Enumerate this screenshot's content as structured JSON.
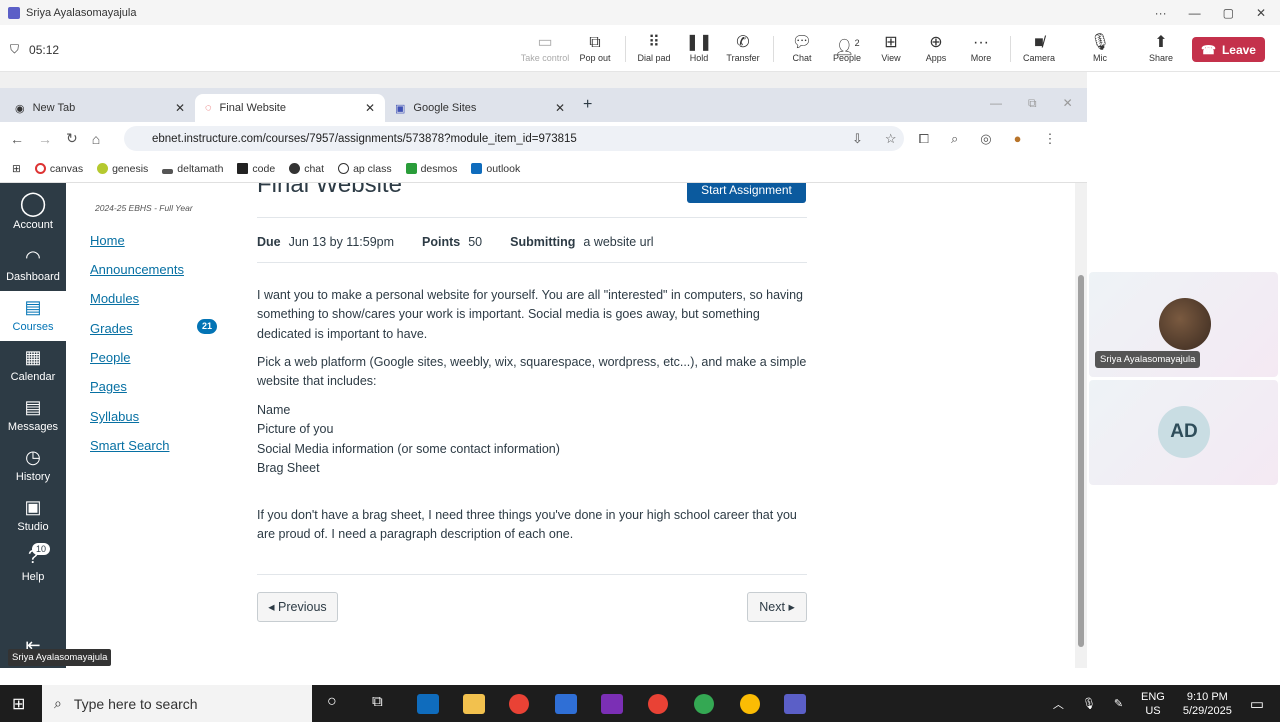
{
  "teams": {
    "window_title": "Sriya Ayalasomayajula",
    "timer": "05:12",
    "toolbar": [
      {
        "label": "Take control",
        "icon": "monitor-icon",
        "disabled": true
      },
      {
        "label": "Pop out",
        "icon": "popout-icon"
      },
      {
        "label": "Dial pad",
        "icon": "dialpad-icon"
      },
      {
        "label": "Hold",
        "icon": "pause-icon"
      },
      {
        "label": "Transfer",
        "icon": "transfer-icon"
      },
      {
        "label": "Chat",
        "icon": "chat-icon"
      },
      {
        "label": "People",
        "icon": "people-icon",
        "count": "2"
      },
      {
        "label": "View",
        "icon": "grid-icon"
      },
      {
        "label": "Apps",
        "icon": "plus-icon"
      },
      {
        "label": "More",
        "icon": "more-icon"
      },
      {
        "label": "Camera",
        "icon": "camera-off-icon"
      },
      {
        "label": "Mic",
        "icon": "mic-icon"
      },
      {
        "label": "Share",
        "icon": "share-icon"
      }
    ],
    "leave": "Leave",
    "participants": [
      {
        "name": "Sriya Ayalasomayajula"
      },
      {
        "initials": "AD"
      }
    ],
    "self_label": "Sriya Ayalasomayajula"
  },
  "browser": {
    "tabs": [
      {
        "label": "New Tab"
      },
      {
        "label": "Final Website"
      },
      {
        "label": "Google Sites"
      }
    ],
    "url": "ebnet.instructure.com/courses/7957/assignments/573878?module_item_id=973815",
    "bookmarks": [
      "canvas",
      "genesis",
      "deltamath",
      "code",
      "chat",
      "ap class",
      "desmos",
      "outlook"
    ]
  },
  "canvas": {
    "global_nav": [
      {
        "label": "Account"
      },
      {
        "label": "Dashboard"
      },
      {
        "label": "Courses"
      },
      {
        "label": "Calendar"
      },
      {
        "label": "Messages"
      },
      {
        "label": "History"
      },
      {
        "label": "Studio"
      },
      {
        "label": "Help",
        "badge": "10"
      }
    ],
    "term": "2024-25 EBHS - Full Year",
    "course_nav": [
      "Home",
      "Announcements",
      "Modules",
      "Grades",
      "People",
      "Pages",
      "Syllabus",
      "Smart Search"
    ],
    "grades_badge": "21",
    "assignment": {
      "title": "Final Website",
      "start_button": "Start Assignment",
      "due_label": "Due",
      "due": "Jun 13 by 11:59pm",
      "points_label": "Points",
      "points": "50",
      "submitting_label": "Submitting",
      "submitting": "a website url",
      "p1": "I want you to make a personal website for yourself. You are all \"interested\" in computers, so having something to show/cares your work is important. Social media is goes away, but something dedicated is important to have.",
      "p2": "Pick a web platform (Google sites, weebly, wix, squarespace, wordpress, etc...), and make a simple website that includes:",
      "list": [
        "Name",
        "Picture of you",
        "Social Media information (or some contact information)",
        "Brag Sheet"
      ],
      "p3": "If you don't have a brag sheet, I need three things you've done in your high school career that you are proud of. I need a paragraph description of each one.",
      "prev": "◂ Previous",
      "next": "Next ▸"
    }
  },
  "taskbar": {
    "search_placeholder": "Type here to search",
    "lang1": "ENG",
    "lang2": "US",
    "time": "9:10 PM",
    "date": "5/29/2025"
  }
}
